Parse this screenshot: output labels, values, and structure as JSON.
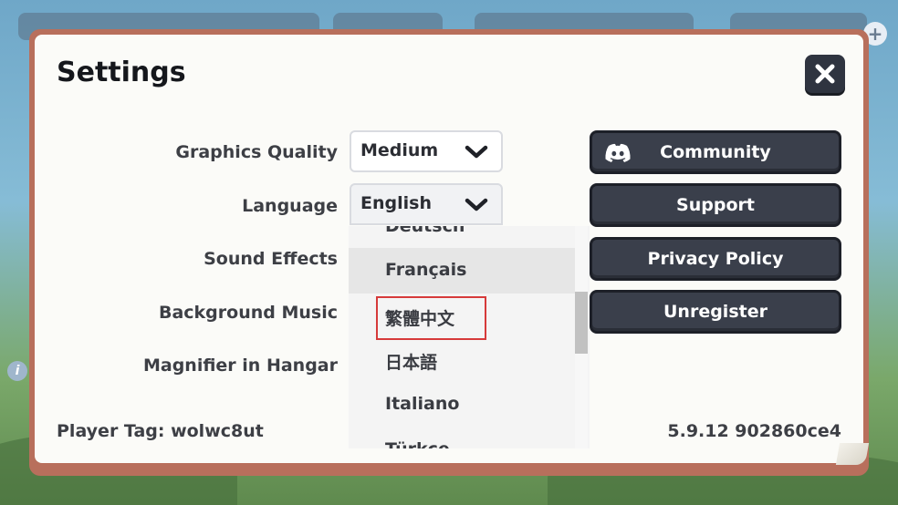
{
  "dialog": {
    "title": "Settings",
    "close_icon": "close-icon"
  },
  "settings": {
    "graphics_quality": {
      "label": "Graphics Quality",
      "value": "Medium"
    },
    "language": {
      "label": "Language",
      "value": "English"
    },
    "sound_effects": {
      "label": "Sound Effects"
    },
    "background_music": {
      "label": "Background Music"
    },
    "magnifier": {
      "label": "Magnifier in Hangar"
    }
  },
  "language_options": [
    "Deutsch",
    "Français",
    "繁體中文",
    "日本語",
    "Italiano",
    "Türkçe"
  ],
  "buttons": {
    "community": "Community",
    "support": "Support",
    "privacy": "Privacy Policy",
    "unregister": "Unregister"
  },
  "footer": {
    "player_tag": "Player Tag: wolwc8ut",
    "version": "5.9.12 902860ce4"
  },
  "colors": {
    "panel_border": "#b86f5c",
    "button_bg": "#3a3f4b",
    "highlight": "#d63a3a"
  }
}
